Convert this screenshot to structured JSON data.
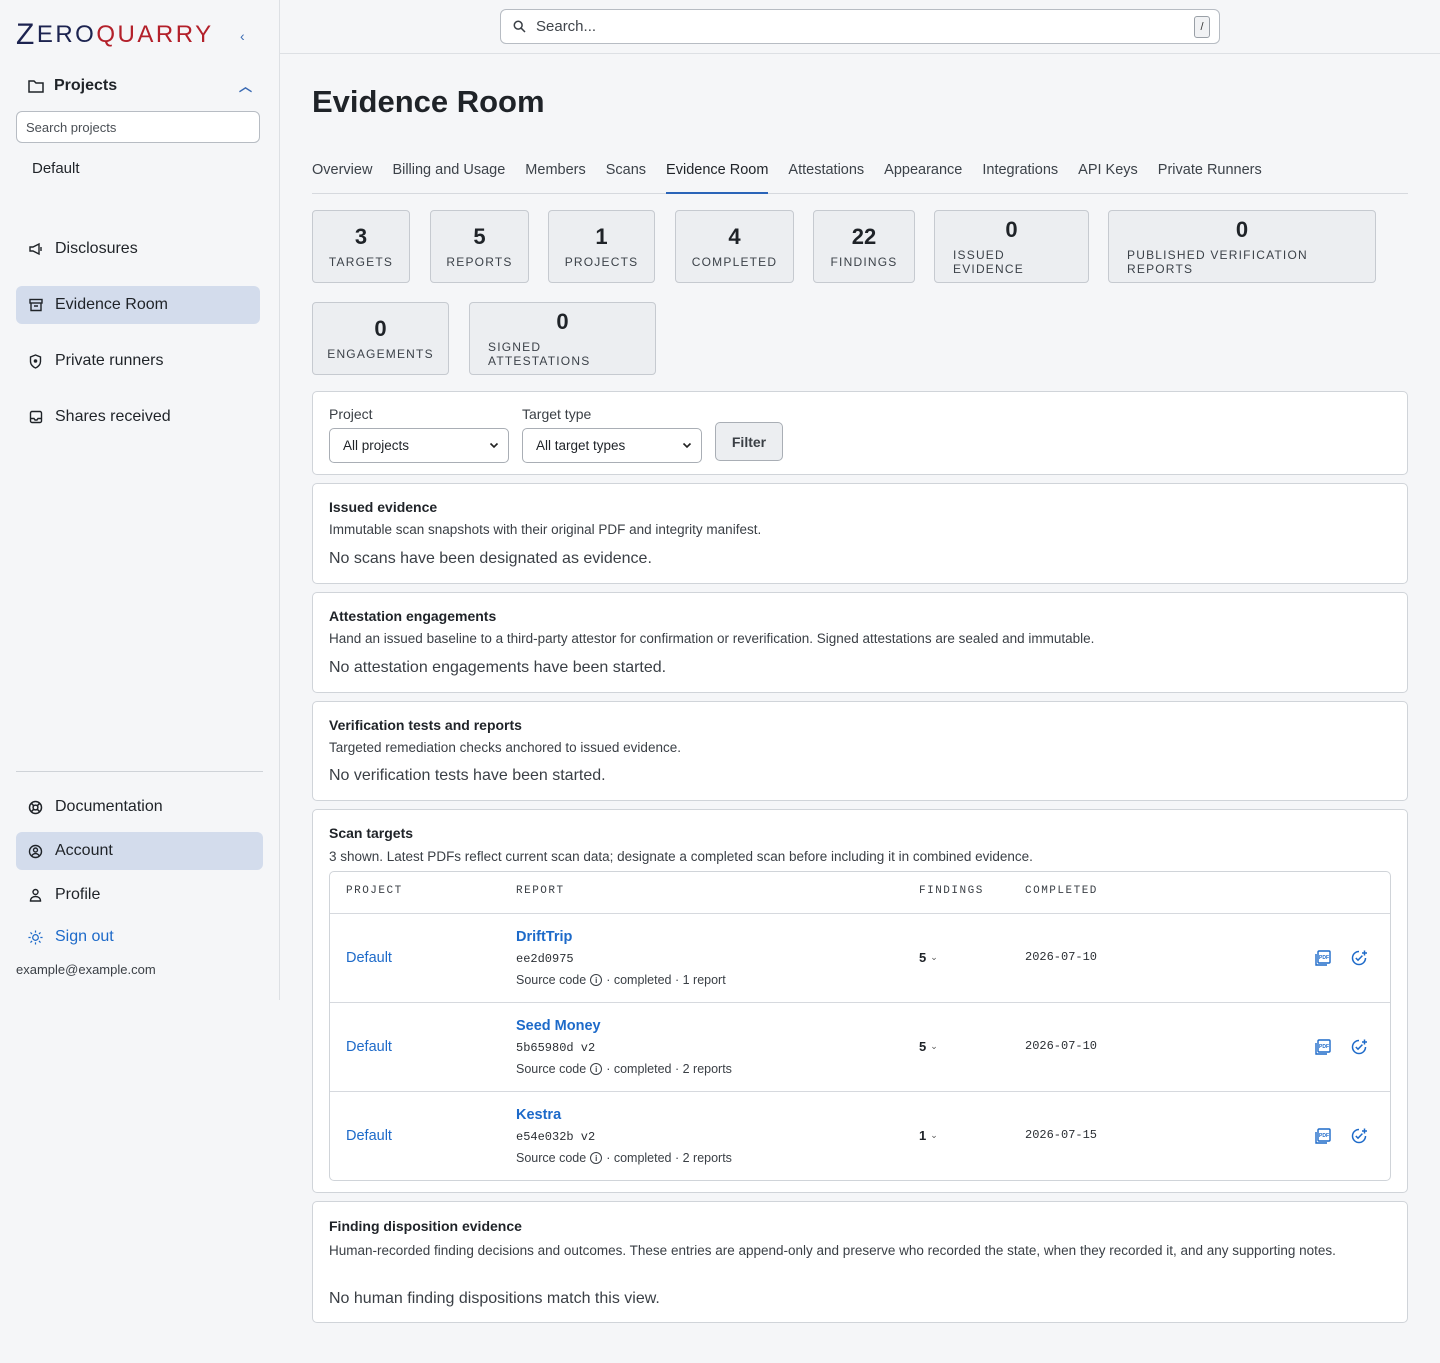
{
  "brand": {
    "z": "Z",
    "ero": "ERO",
    "q": "Q",
    "uarry": "UARRY"
  },
  "sidebar": {
    "collapse_glyph": "‹",
    "projects_label": "Projects",
    "projects_search_placeholder": "Search projects",
    "default_project": "Default",
    "nav": [
      {
        "label": "Disclosures",
        "icon": "megaphone-icon"
      },
      {
        "label": "Evidence Room",
        "icon": "archive-icon",
        "active": true
      },
      {
        "label": "Private runners",
        "icon": "shield-icon"
      },
      {
        "label": "Shares received",
        "icon": "inbox-icon"
      }
    ],
    "bottom": [
      {
        "label": "Documentation",
        "icon": "lifebuoy-icon"
      },
      {
        "label": "Account",
        "icon": "user-circle-icon",
        "active": true
      },
      {
        "label": "Profile",
        "icon": "person-icon"
      },
      {
        "label": "Sign out",
        "icon": "sun-icon"
      }
    ],
    "email": "example@example.com"
  },
  "topbar": {
    "search_placeholder": "Search...",
    "shortcut": "/"
  },
  "page": {
    "title": "Evidence Room"
  },
  "tabs": [
    "Overview",
    "Billing and Usage",
    "Members",
    "Scans",
    "Evidence Room",
    "Attestations",
    "Appearance",
    "Integrations",
    "API Keys",
    "Private Runners"
  ],
  "active_tab": "Evidence Room",
  "stats": [
    {
      "value": "3",
      "label": "Targets"
    },
    {
      "value": "5",
      "label": "Reports"
    },
    {
      "value": "1",
      "label": "Projects"
    },
    {
      "value": "4",
      "label": "Completed"
    },
    {
      "value": "22",
      "label": "Findings"
    },
    {
      "value": "0",
      "label": "Issued evidence"
    },
    {
      "value": "0",
      "label": "Published verification reports"
    },
    {
      "value": "0",
      "label": "Engagements"
    },
    {
      "value": "0",
      "label": "Signed attestations"
    }
  ],
  "filter": {
    "project_label": "Project",
    "project_value": "All projects",
    "target_label": "Target type",
    "target_value": "All target types",
    "button": "Filter"
  },
  "sections": {
    "issued": {
      "title": "Issued evidence",
      "desc": "Immutable scan snapshots with their original PDF and integrity manifest.",
      "empty": "No scans have been designated as evidence."
    },
    "attestation": {
      "title": "Attestation engagements",
      "desc": "Hand an issued baseline to a third-party attestor for confirmation or reverification. Signed attestations are sealed and immutable.",
      "empty": "No attestation engagements have been started."
    },
    "verification": {
      "title": "Verification tests and reports",
      "desc": "Targeted remediation checks anchored to issued evidence.",
      "empty": "No verification tests have been started."
    },
    "targets": {
      "title": "Scan targets",
      "desc": "3 shown. Latest PDFs reflect current scan data; designate a completed scan before including it in combined evidence."
    },
    "disposition": {
      "title": "Finding disposition evidence",
      "desc": "Human-recorded finding decisions and outcomes. These entries are append-only and preserve who recorded the state, when they recorded it, and any supporting notes.",
      "empty": "No human finding dispositions match this view."
    }
  },
  "table": {
    "headers": [
      "PROJECT",
      "REPORT",
      "FINDINGS",
      "COMPLETED"
    ],
    "rows": [
      {
        "project": "Default",
        "report": "DriftTrip",
        "hash": "ee2d0975",
        "type": "Source code",
        "meta": "· completed · 1 report",
        "findings": "5",
        "completed": "2026-07-10"
      },
      {
        "project": "Default",
        "report": "Seed Money",
        "hash": "5b65980d v2",
        "type": "Source code",
        "meta": "· completed · 2 reports",
        "findings": "5",
        "completed": "2026-07-10"
      },
      {
        "project": "Default",
        "report": "Kestra",
        "hash": "e54e032b v2",
        "type": "Source code",
        "meta": "· completed · 2 reports",
        "findings": "1",
        "completed": "2026-07-15"
      }
    ]
  },
  "colors": {
    "accent": "#1d6ac9",
    "active_nav": "#d3dcec",
    "brand_navy": "#1c2350",
    "brand_red": "#b3202a"
  }
}
